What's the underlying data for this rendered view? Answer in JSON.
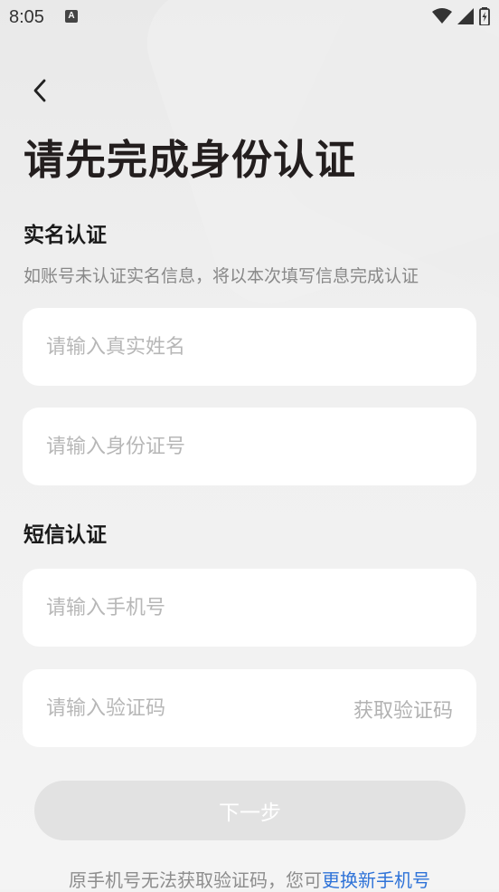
{
  "status_bar": {
    "time": "8:05",
    "notification_letter": "A"
  },
  "page": {
    "title": "请先完成身份认证"
  },
  "real_name_section": {
    "title": "实名认证",
    "subtitle": "如账号未认证实名信息，将以本次填写信息完成认证",
    "name_input": {
      "value": "",
      "placeholder": "请输入真实姓名"
    },
    "id_input": {
      "value": "",
      "placeholder": "请输入身份证号"
    }
  },
  "sms_section": {
    "title": "短信认证",
    "phone_input": {
      "value": "",
      "placeholder": "请输入手机号"
    },
    "code_input": {
      "value": "",
      "placeholder": "请输入验证码"
    },
    "get_code_label": "获取验证码"
  },
  "next_button": {
    "label": "下一步"
  },
  "footer": {
    "text": "原手机号无法获取验证码，您可",
    "link": "更换新手机号"
  },
  "colors": {
    "link": "#2f73d8",
    "button_disabled": "#e2e2e2",
    "title": "#231e1e"
  }
}
